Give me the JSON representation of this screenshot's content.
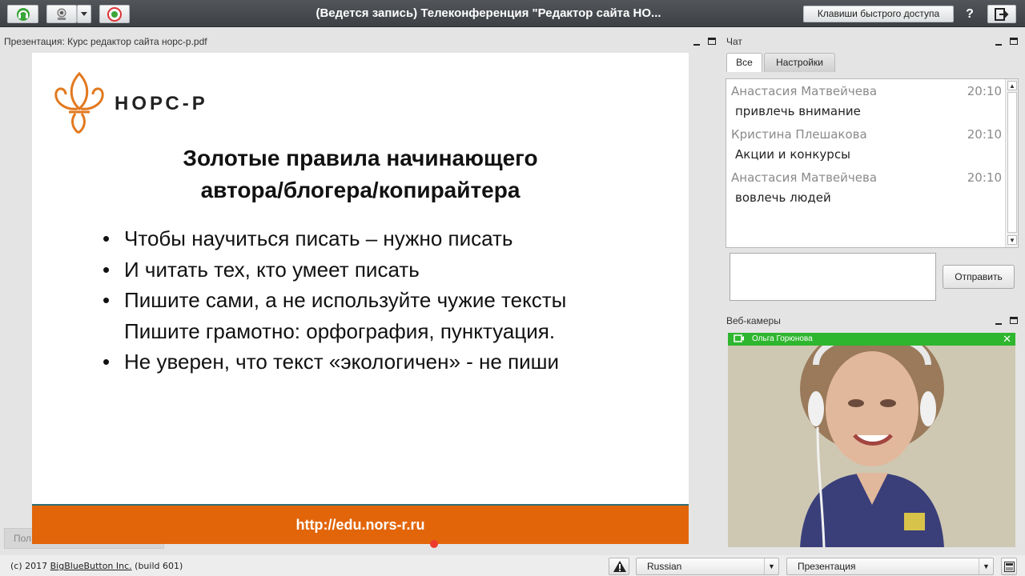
{
  "topbar": {
    "title": "(Ведется запись) Телеконференция \"Редактор сайта НО...",
    "shortcut_label": "Клавиши быстрого доступа",
    "help_label": "?"
  },
  "presentation": {
    "window_title": "Презентация: Курс редактор сайта норс-р.pdf",
    "logo_text": "НОРС-Р",
    "slide_title_line1": "Золотые правила начинающего",
    "slide_title_line2": "автора/блогера/копирайтера",
    "bullets": [
      "Чтобы научиться писать – нужно писать",
      "И читать тех, кто умеет писать",
      "Пишите сами, а не используйте чужие тексты",
      "Пишите грамотно: орфография, пунктуация.",
      "Не уверен, что текст «экологичен» - не пиши"
    ],
    "footer_url": "http://edu.nors-r.ru",
    "hidden_button_label": "Пол"
  },
  "chat": {
    "window_title": "Чат",
    "tabs": [
      {
        "label": "Все"
      },
      {
        "label": "Настройки"
      }
    ],
    "messages": [
      {
        "name": "Анастасия Матвейчева",
        "time": "20:10",
        "text": "привлечь внимание"
      },
      {
        "name": "Кристина Плешакова",
        "time": "20:10",
        "text": "Акции и конкурсы"
      },
      {
        "name": "Анастасия Матвейчева",
        "time": "20:10",
        "text": "вовлечь людей"
      }
    ],
    "send_label": "Отправить"
  },
  "webcams": {
    "window_title": "Веб-камеры",
    "user_name": "Ольга Горюнова",
    "close_label": "✕"
  },
  "footer": {
    "copyright_prefix": "(c) 2017 ",
    "copyright_link": "BigBlueButton Inc.",
    "copyright_suffix": " (build 601)",
    "language": "Russian",
    "layout": "Презентация"
  },
  "colors": {
    "accent_orange": "#e2650a",
    "webcam_bar": "#2fb62f",
    "topbar": "#45484c"
  }
}
